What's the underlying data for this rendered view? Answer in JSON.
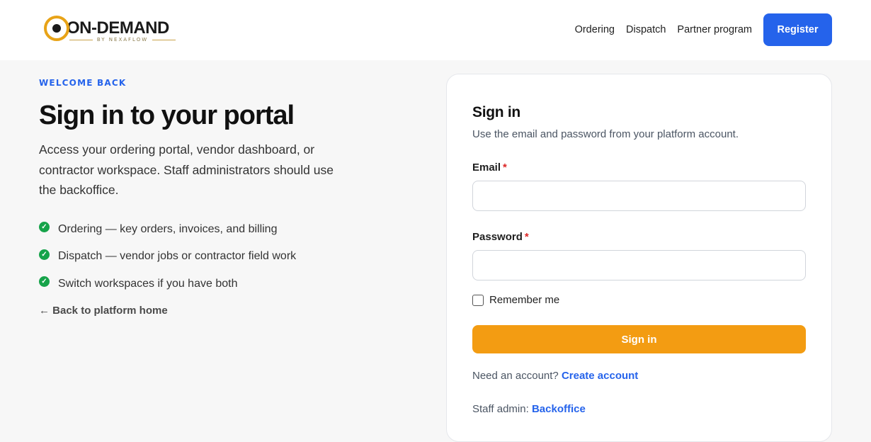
{
  "header": {
    "logo": {
      "wordmark": "ON-DEMAND",
      "byline": "BY NEXAFLOW"
    },
    "nav": [
      "Ordering",
      "Dispatch",
      "Partner program"
    ],
    "register_label": "Register"
  },
  "hero": {
    "eyebrow": "WELCOME BACK",
    "title": "Sign in to your portal",
    "intro": "Access your ordering portal, vendor dashboard, or contractor workspace. Staff administrators should use the backoffice.",
    "features": [
      "Ordering — key orders, invoices, and billing",
      "Dispatch — vendor jobs or contractor field work",
      "Switch workspaces if you have both"
    ],
    "back_link": "← Back to platform home"
  },
  "signin": {
    "title": "Sign in",
    "subtitle": "Use the email and password from your platform account.",
    "email_label": "Email",
    "email_value": "",
    "password_label": "Password",
    "password_value": "",
    "required_mark": "*",
    "remember_label": "Remember me",
    "remember_checked": false,
    "submit_label": "Sign in",
    "create_prompt": "Need an account?",
    "create_link": "Create account",
    "staff_prompt": "Staff admin:",
    "staff_link": "Backoffice"
  },
  "colors": {
    "accent_blue": "#2563eb",
    "accent_orange": "#f39c12",
    "check_green": "#16a34a",
    "logo_gold": "#e8a317"
  }
}
